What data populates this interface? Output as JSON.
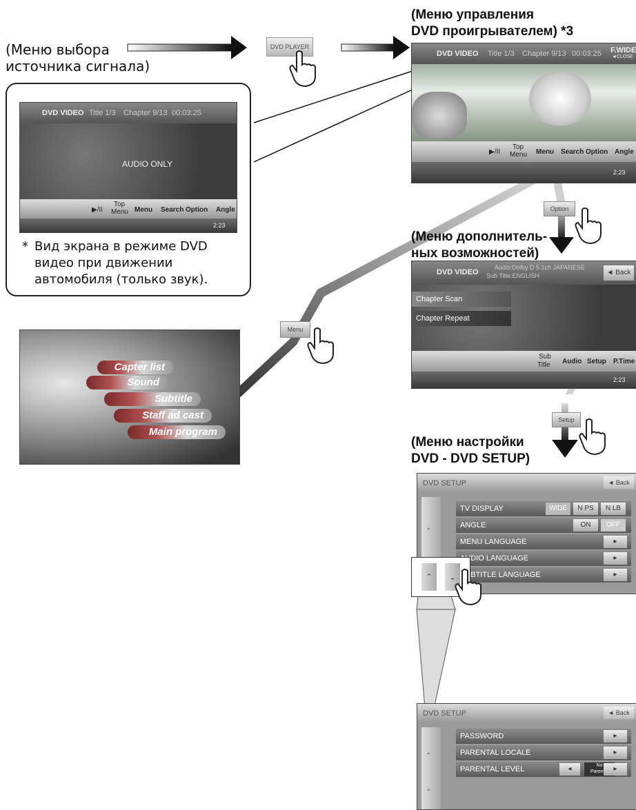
{
  "labels": {
    "source_menu_line1": "(Меню выбора",
    "source_menu_line2": "источника сигнала)",
    "dvd_control_line1": "(Меню управления",
    "dvd_control_line2": "DVD проигрывателем) *3",
    "options_line1": "(Меню дополнитель-",
    "options_line2": "ных возможностей)",
    "setup_line1": "(Меню настройки",
    "setup_line2": "DVD - DVD SETUP)"
  },
  "note": {
    "star": "*",
    "line1": "Вид экрана в режиме DVD",
    "line2": "видео при движении",
    "line3": "автомобиля (только звук)."
  },
  "buttons": {
    "dvd_player": "DVD PLAYER",
    "option": "Option",
    "menu": "Menu",
    "setup": "Setup"
  },
  "player_screen": {
    "mode": "DVD VIDEO",
    "title": "Title 1/3",
    "chapter": "Chapter 9/13",
    "time": "00:03:25",
    "wide": "F.WIDE",
    "close": "◄CLOSE",
    "play_pause": "▶/II",
    "top_menu_1": "Top",
    "top_menu_2": "Menu",
    "menu": "Menu",
    "search": "Search",
    "option": "Option",
    "angle": "Angle",
    "clock": "2:23"
  },
  "audio_only_screen": {
    "mode": "DVD VIDEO",
    "title": "Title 1/3",
    "chapter": "Chapter 9/13",
    "time": "00:03:25",
    "center_text": "AUDIO ONLY",
    "play_pause": "▶/II",
    "top_menu_1": "Top",
    "top_menu_2": "Menu",
    "menu": "Menu",
    "search": "Search",
    "option": "Option",
    "angle": "Angle",
    "clock": "2:23"
  },
  "options_screen": {
    "mode": "DVD VIDEO",
    "audio_info": "Audio:Dolby D 5.1ch JAPANESE",
    "subtitle_info": "Sub Title:ENGLISH",
    "back": "◄ Back",
    "items": [
      "Chapter Scan",
      "Chapter Repeat"
    ],
    "sub_1": "Sub",
    "sub_2": "Title",
    "audio": "Audio",
    "setup": "Setup",
    "ptime": "P.Time",
    "clock": "2:23"
  },
  "disc_menu": {
    "items": [
      "Capter list",
      "Sound",
      "Subtitle",
      "Staff ad cast",
      "Main program"
    ]
  },
  "setup_screen_1": {
    "title": "DVD SETUP",
    "back": "◄ Back",
    "rows": [
      "TV DISPLAY",
      "ANGLE",
      "MENU LANGUAGE",
      "AUDIO LANGUAGE",
      "SUBTITLE LANGUAGE"
    ],
    "tv_options": [
      "WIDE",
      "N PS",
      "N LB"
    ],
    "angle_options": [
      "ON",
      "OFF"
    ]
  },
  "setup_screen_2": {
    "title": "DVD SETUP",
    "back": "◄ Back",
    "rows": [
      "PASSWORD",
      "PARENTAL LOCALE",
      "PARENTAL LEVEL"
    ],
    "level_value_1": "No",
    "level_value_2": "Parental"
  },
  "scroll_icons": [
    "scroll-up-icon",
    "scroll-down-icon"
  ]
}
